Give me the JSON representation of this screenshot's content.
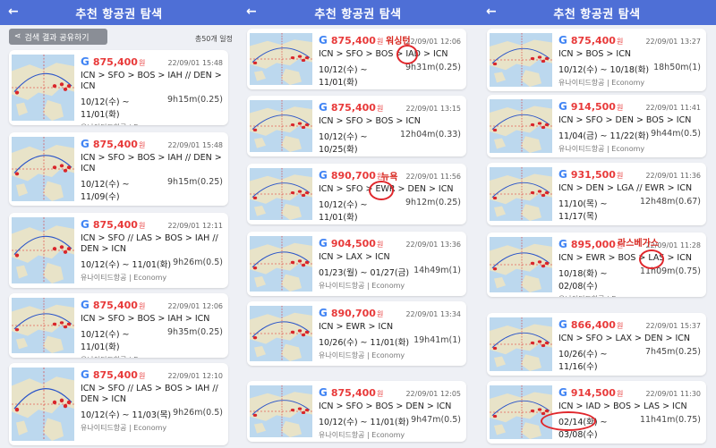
{
  "header": {
    "title": "추천 항공권 탐색"
  },
  "toolbar": {
    "share_label": "검색 결과 공유하기",
    "count": "총50개 일정"
  },
  "currency": "원",
  "airline_label": "유나이티드항공 | Economy",
  "panels": [
    {
      "cards": [
        {
          "price": "875,400",
          "ts": "22/09/01 15:48",
          "route": "ICN > SFO > BOS > IAH // DEN > ICN",
          "dates": "10/12(수) ~ 11/01(화)",
          "dur": "9h15m(0.25)"
        },
        {
          "price": "875,400",
          "ts": "22/09/01 15:48",
          "route": "ICN > SFO > BOS > IAH // DEN > ICN",
          "dates": "10/12(수) ~ 11/09(수)",
          "dur": "9h15m(0.25)"
        },
        {
          "price": "875,400",
          "ts": "22/09/01 12:11",
          "route": "ICN > SFO // LAS > BOS > IAH // DEN > ICN",
          "dates": "10/12(수) ~ 11/01(화)",
          "dur": "9h26m(0.5)"
        },
        {
          "price": "875,400",
          "ts": "22/09/01 12:06",
          "route": "ICN > SFO > BOS > IAH > ICN",
          "dates": "10/12(수) ~ 11/01(화)",
          "dur": "9h35m(0.25)"
        },
        {
          "price": "875,400",
          "ts": "22/09/01 12:10",
          "route": "ICN > SFO // LAS > BOS > IAH // DEN > ICN",
          "dates": "10/12(수) ~ 11/03(목)",
          "dur": "9h26m(0.5)"
        }
      ]
    },
    {
      "cards": [
        {
          "price": "875,400",
          "ts": "22/09/01 12:06",
          "route": "ICN > SFO > BOS > IAD > ICN",
          "dates": "10/12(수) ~ 11/01(화)",
          "dur": "9h31m(0.25)"
        },
        {
          "price": "875,400",
          "ts": "22/09/01 13:15",
          "route": "ICN > SFO > BOS > ICN",
          "dates": "10/12(수) ~ 10/25(화)",
          "dur": "12h04m(0.33)"
        },
        {
          "price": "890,700",
          "ts": "22/09/01 11:56",
          "route": "ICN > SFO > EWR > DEN > ICN",
          "dates": "10/12(수) ~ 11/01(화)",
          "dur": "9h12m(0.25)"
        },
        {
          "price": "904,500",
          "ts": "22/09/01 13:36",
          "route": "ICN > LAX > ICN",
          "dates": "01/23(월) ~ 01/27(금)",
          "dur": "14h49m(1)"
        },
        {
          "price": "890,700",
          "ts": "22/09/01 13:34",
          "route": "ICN > EWR > ICN",
          "dates": "10/26(수) ~ 11/01(화)",
          "dur": "19h41m(1)"
        },
        {
          "price": "875,400",
          "ts": "22/09/01 12:05",
          "route": "ICN > SFO > BOS > DEN > ICN",
          "dates": "10/12(수) ~ 11/01(화)",
          "dur": "9h47m(0.5)"
        }
      ]
    },
    {
      "cards": [
        {
          "price": "875,400",
          "ts": "22/09/01 13:27",
          "route": "ICN > BOS > ICN",
          "dates": "10/12(수) ~ 10/18(화)",
          "dur": "18h50m(1)"
        },
        {
          "price": "914,500",
          "ts": "22/09/01 11:41",
          "route": "ICN > SFO > DEN > BOS > ICN",
          "dates": "11/04(금) ~ 11/22(화)",
          "dur": "9h44m(0.5)"
        },
        {
          "price": "931,500",
          "ts": "22/09/01 11:36",
          "route": "ICN > DEN > LGA // EWR > ICN",
          "dates": "11/10(목) ~ 11/17(목)",
          "dur": "12h48m(0.67)"
        },
        {
          "price": "895,000",
          "ts": "22/09/01 11:28",
          "route": "ICN > EWR > BOS > LAS > ICN",
          "dates": "10/18(화) ~ 02/08(수)",
          "dur": "11h09m(0.75)"
        },
        {
          "price": "866,400",
          "ts": "22/09/01 15:37",
          "route": "ICN > SFO > LAX > DEN > ICN",
          "dates": "10/26(수) ~ 11/16(수)",
          "dur": "7h45m(0.25)"
        },
        {
          "price": "914,500",
          "ts": "22/09/01 11:30",
          "route": "ICN > IAD > BOS > LAS > ICN",
          "dates": "02/14(화) ~ 03/08(수)",
          "dur": "11h41m(0.75)"
        }
      ]
    }
  ],
  "annotations": {
    "a1": "워싱턴",
    "a2": "뉴욕",
    "a3": "라스베가스"
  }
}
